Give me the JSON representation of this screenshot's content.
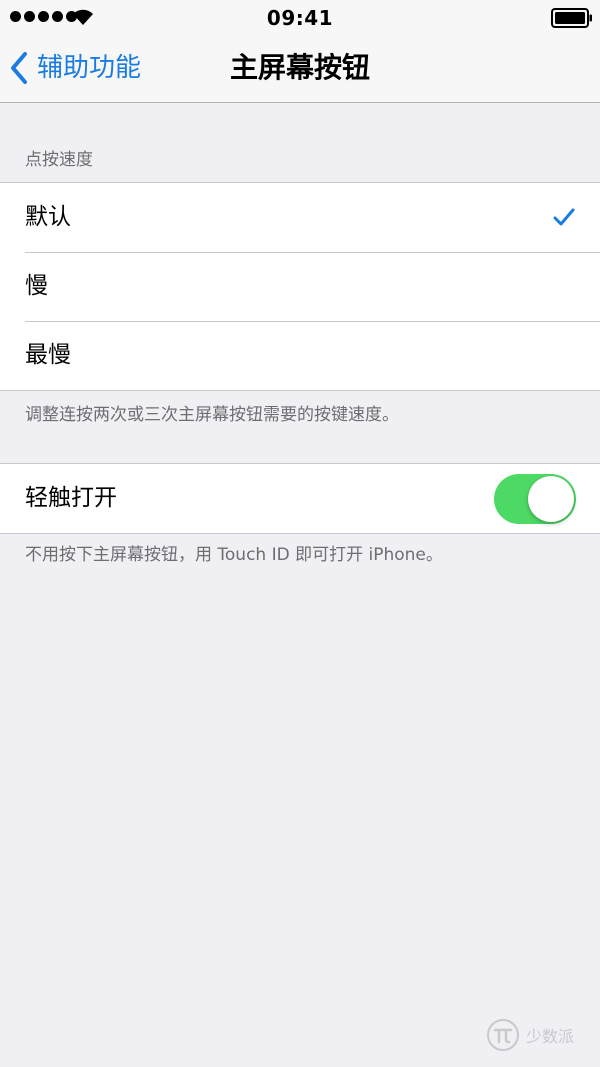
{
  "status_bar": {
    "time": "09:41",
    "signal_icon": "signal-dots-icon",
    "wifi_icon": "wifi-icon",
    "battery_icon": "battery-icon"
  },
  "nav": {
    "back_label": "辅助功能",
    "back_icon": "chevron-left-icon",
    "title": "主屏幕按钮"
  },
  "click_speed": {
    "header": "点按速度",
    "options": [
      {
        "label": "默认",
        "selected": true
      },
      {
        "label": "慢",
        "selected": false
      },
      {
        "label": "最慢",
        "selected": false
      }
    ],
    "footer": "调整连按两次或三次主屏幕按钮需要的按键速度。"
  },
  "rest_finger": {
    "label": "轻触打开",
    "enabled": true,
    "footer": "不用按下主屏幕按钮，用 Touch ID 即可打开 iPhone。"
  },
  "watermark": {
    "text": "少数派"
  },
  "colors": {
    "accent": "#1a7ce1",
    "toggle_on": "#4cd964",
    "background": "#efeff4"
  }
}
